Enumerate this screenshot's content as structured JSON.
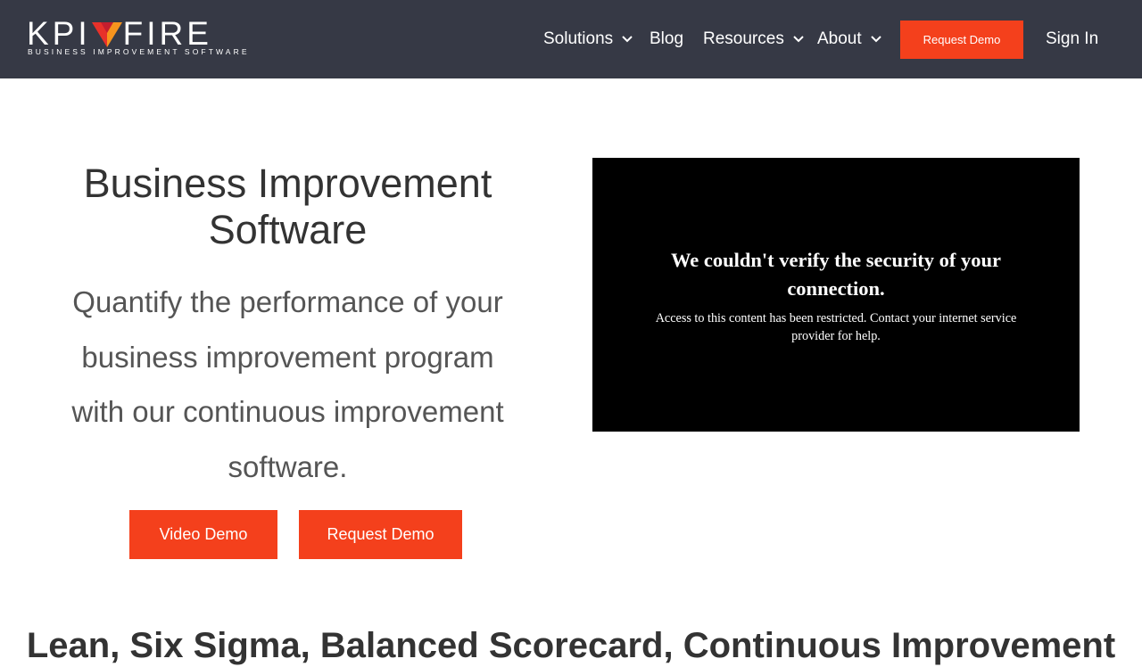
{
  "nav": {
    "logo": {
      "left": "KPI",
      "right": "FIRE",
      "tagline": "BUSINESS IMPROVEMENT SOFTWARE"
    },
    "items": [
      {
        "label": "Solutions",
        "has_dropdown": true
      },
      {
        "label": "Blog",
        "has_dropdown": false
      },
      {
        "label": "Resources",
        "has_dropdown": true
      },
      {
        "label": "About",
        "has_dropdown": true
      }
    ],
    "request_demo_label": "Request Demo",
    "sign_in_label": "Sign In"
  },
  "hero": {
    "title": "Business Improvement Software",
    "subtitle": "Quantify the performance of your business improvement program with our continuous improvement software.",
    "video_demo_label": "Video Demo",
    "request_demo_label": "Request Demo"
  },
  "video_embed": {
    "heading": "We couldn't verify the security of your connection.",
    "message": "Access to this content has been restricted. Contact your internet service provider for help."
  },
  "section": {
    "heading": "Lean, Six Sigma, Balanced Scorecard, Continuous Improvement"
  },
  "colors": {
    "nav_bg": "#363945",
    "accent": "#f4401c",
    "logo_red": "#e8312a",
    "logo_orange": "#f7941d"
  }
}
